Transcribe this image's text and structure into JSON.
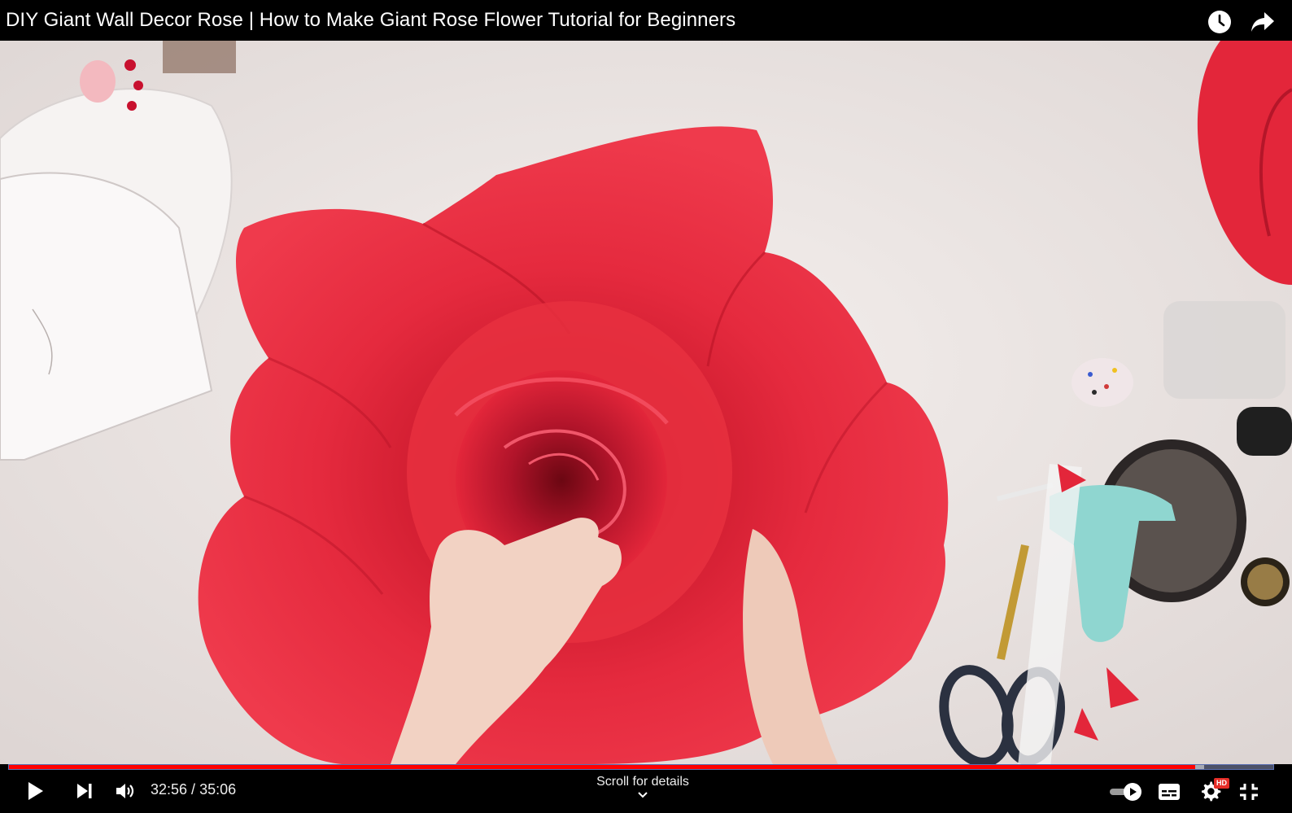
{
  "video": {
    "title": "DIY Giant Wall Decor Rose | How to Make Giant Rose Flower Tutorial for Beginners",
    "current_time": "32:56",
    "separator": " / ",
    "duration": "35:06",
    "progress_fraction": 0.938,
    "buffer_fraction": 0.945
  },
  "top_actions": {
    "watch_later_icon": "clock-icon",
    "share_icon": "share-arrow-icon"
  },
  "controls": {
    "play_icon": "play-icon",
    "next_icon": "skip-next-icon",
    "volume_icon": "volume-icon",
    "scroll_hint": "Scroll for details",
    "autoplay_icon": "autoplay-toggle-icon",
    "subtitles_icon": "subtitles-icon",
    "settings_icon": "gear-icon",
    "settings_badge": "HD",
    "fullscreen_exit_icon": "exit-fullscreen-icon"
  },
  "colors": {
    "progress_played": "#ff0000",
    "hd_badge": "#e52d27",
    "rose": "#e3263a"
  }
}
